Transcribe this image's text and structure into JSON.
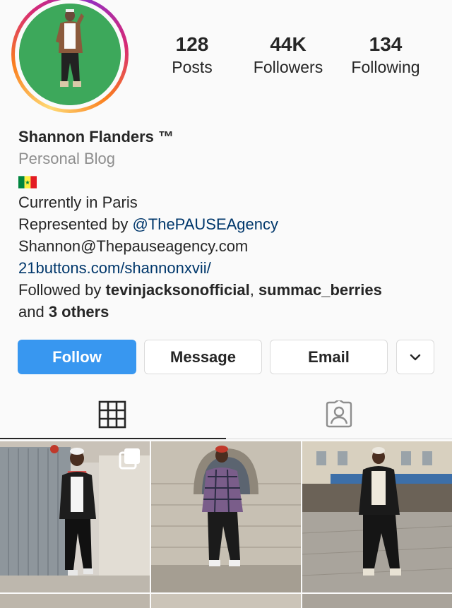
{
  "profile": {
    "stats": [
      {
        "value": "128",
        "label": "Posts"
      },
      {
        "value": "44K",
        "label": "Followers"
      },
      {
        "value": "134",
        "label": "Following"
      }
    ],
    "name": "Shannon Flanders ™",
    "category": "Personal Blog",
    "bio_lines": [
      "Currently in Paris"
    ],
    "represented_prefix": "Represented by ",
    "represented_handle": "@ThePAUSEAgency",
    "email": "Shannon@Thepauseagency.com",
    "website": "21buttons.com/shannonxvii/",
    "followed_by_prefix": "Followed by ",
    "followed_by_user1": "tevinjacksonofficial",
    "followed_by_sep": ", ",
    "followed_by_user2": "summac_berries",
    "followed_by_and": "and ",
    "followed_by_others": "3 others"
  },
  "actions": {
    "follow": "Follow",
    "message": "Message",
    "email": "Email"
  },
  "colors": {
    "primary_button": "#3897f0",
    "link": "#00376b",
    "muted": "#8e8e8e",
    "avatar_bg": "#3da85b"
  },
  "icons": {
    "grid_tab": "grid-icon",
    "tagged_tab": "tagged-person-icon",
    "dropdown": "chevron-down-icon",
    "multi_post": "multiple-posts-icon"
  }
}
